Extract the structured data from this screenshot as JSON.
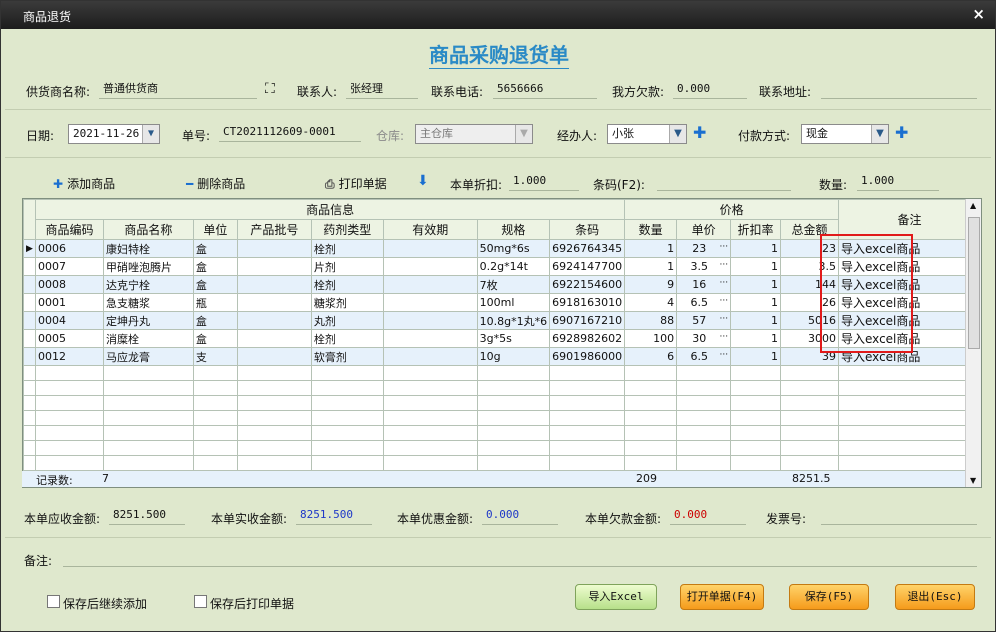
{
  "window": {
    "title": "商品退货",
    "close": "×"
  },
  "form_title": "商品采购退货单",
  "row1": {
    "supplier_label": "供货商名称:",
    "supplier_value": "普通供货商",
    "contact_label": "联系人:",
    "contact_value": "张经理",
    "phone_label": "联系电话:",
    "phone_value": "5656666",
    "debt_label": "我方欠款:",
    "debt_value": "0.000",
    "address_label": "联系地址:",
    "address_value": ""
  },
  "row2": {
    "date_label": "日期:",
    "date_value": "2021-11-26",
    "order_label": "单号:",
    "order_value": "CT2021112609-0001",
    "warehouse_label": "仓库:",
    "warehouse_value": "主仓库",
    "handler_label": "经办人:",
    "handler_value": "小张",
    "payment_label": "付款方式:",
    "payment_value": "现金"
  },
  "toolbar": {
    "add_label": "添加商品",
    "delete_label": "删除商品",
    "print_label": "打印单据",
    "discount_label": "本单折扣:",
    "discount_value": "1.000",
    "barcode_label": "条码(F2):",
    "barcode_value": "",
    "qty_label": "数量:",
    "qty_value": "1.000"
  },
  "grid": {
    "group_product": "商品信息",
    "group_price": "价格",
    "remark_header": "备注",
    "columns": [
      "商品编码",
      "商品名称",
      "单位",
      "产品批号",
      "药剂类型",
      "有效期",
      "规格",
      "条码",
      "数量",
      "单价",
      "折扣率",
      "总金额"
    ],
    "rows": [
      {
        "code": "0006",
        "name": "康妇特栓",
        "unit": "盒",
        "batch": "",
        "type": "栓剂",
        "expiry": "",
        "spec": "50mg*6s",
        "barcode": "6926764345",
        "qty": "1",
        "price": "23",
        "discount": "1",
        "total": "23",
        "remark": "导入excel商品"
      },
      {
        "code": "0007",
        "name": "甲硝唑泡腾片",
        "unit": "盒",
        "batch": "",
        "type": "片剂",
        "expiry": "",
        "spec": "0.2g*14t",
        "barcode": "6924147700",
        "qty": "1",
        "price": "3.5",
        "discount": "1",
        "total": "3.5",
        "remark": "导入excel商品"
      },
      {
        "code": "0008",
        "name": "达克宁栓",
        "unit": "盒",
        "batch": "",
        "type": "栓剂",
        "expiry": "",
        "spec": "7枚",
        "barcode": "6922154600",
        "qty": "9",
        "price": "16",
        "discount": "1",
        "total": "144",
        "remark": "导入excel商品"
      },
      {
        "code": "0001",
        "name": "急支糖浆",
        "unit": "瓶",
        "batch": "",
        "type": "糖浆剂",
        "expiry": "",
        "spec": "100ml",
        "barcode": "6918163010",
        "qty": "4",
        "price": "6.5",
        "discount": "1",
        "total": "26",
        "remark": "导入excel商品"
      },
      {
        "code": "0004",
        "name": "定坤丹丸",
        "unit": "盒",
        "batch": "",
        "type": "丸剂",
        "expiry": "",
        "spec": "10.8g*1丸*6",
        "barcode": "6907167210",
        "qty": "88",
        "price": "57",
        "discount": "1",
        "total": "5016",
        "remark": "导入excel商品"
      },
      {
        "code": "0005",
        "name": "消糜栓",
        "unit": "盒",
        "batch": "",
        "type": "栓剂",
        "expiry": "",
        "spec": "3g*5s",
        "barcode": "6928982602",
        "qty": "100",
        "price": "30",
        "discount": "1",
        "total": "3000",
        "remark": "导入excel商品"
      },
      {
        "code": "0012",
        "name": "马应龙膏",
        "unit": "支",
        "batch": "",
        "type": "软膏剂",
        "expiry": "",
        "spec": "10g",
        "barcode": "6901986000",
        "qty": "6",
        "price": "6.5",
        "discount": "1",
        "total": "39",
        "remark": "导入excel商品"
      }
    ],
    "footer": {
      "count_label": "记录数:",
      "count_value": "7",
      "qty_total": "209",
      "amount_total": "8251.5"
    },
    "ellipsis": "···"
  },
  "totals": {
    "receivable_label": "本单应收金额:",
    "receivable_value": "8251.500",
    "received_label": "本单实收金额:",
    "received_value": "8251.500",
    "discount_label": "本单优惠金额:",
    "discount_value": "0.000",
    "owed_label": "本单欠款金额:",
    "owed_value": "0.000",
    "invoice_label": "发票号:",
    "invoice_value": ""
  },
  "remark": {
    "label": "备注:",
    "value": ""
  },
  "bottom": {
    "continue_label": "保存后继续添加",
    "print_after_label": "保存后打印单据",
    "import_btn": "导入Excel",
    "open_btn": "打开单据(F4)",
    "save_btn": "保存(F5)",
    "exit_btn": "退出(Esc)"
  },
  "colors": {
    "title_blue": "#2a8ac6",
    "accent_blue": "#1a6fd0",
    "highlight_red": "#e11a1a",
    "panel_bg": "#dfe8cd"
  }
}
